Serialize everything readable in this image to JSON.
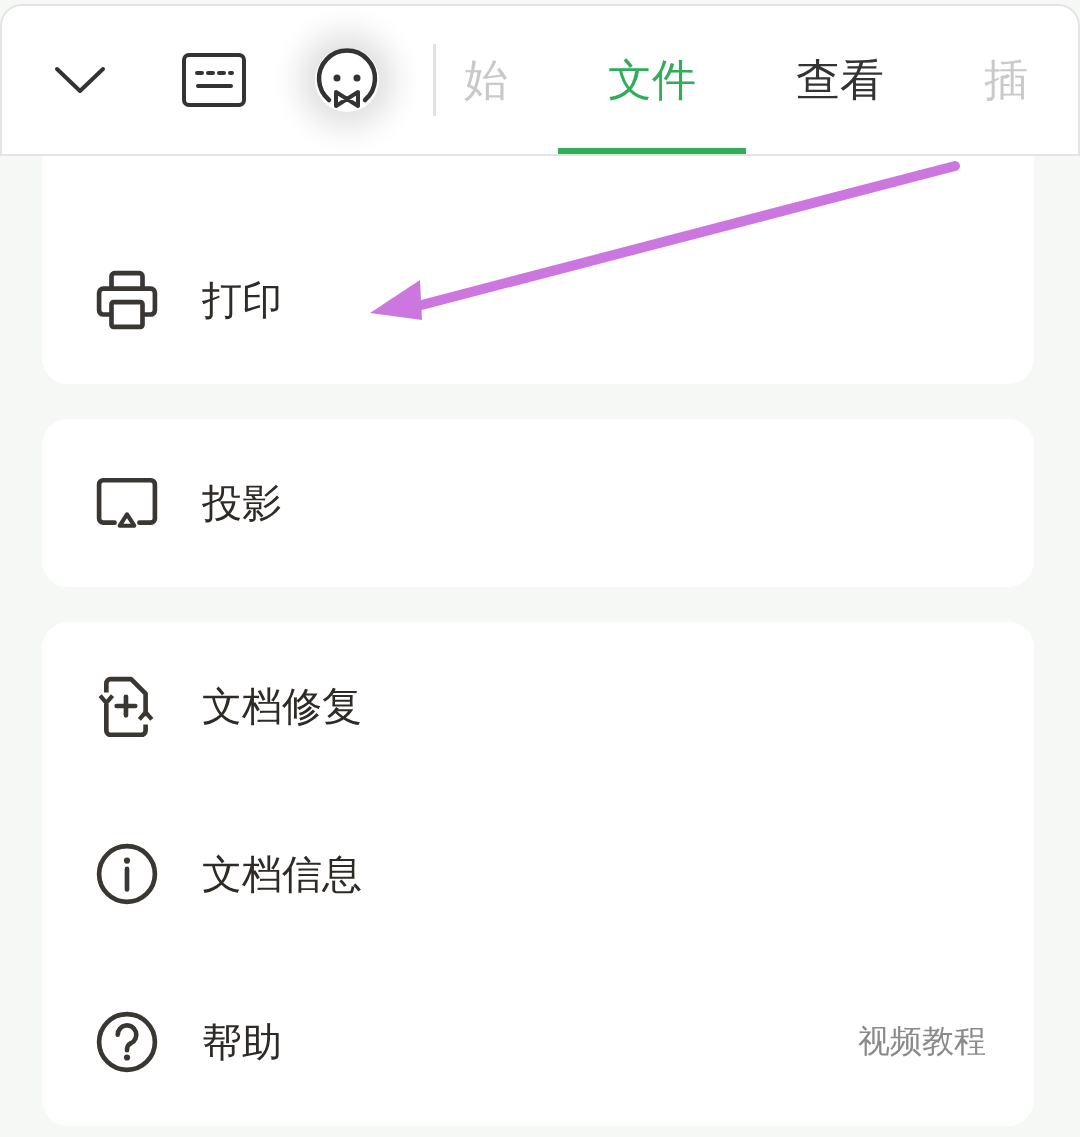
{
  "toolbar": {
    "tabs": [
      {
        "label": "始",
        "selected": false,
        "faded": true
      },
      {
        "label": "文件",
        "selected": true,
        "faded": false
      },
      {
        "label": "查看",
        "selected": false,
        "faded": false
      },
      {
        "label": "插",
        "selected": false,
        "faded": true
      }
    ]
  },
  "groups": [
    {
      "items": [
        {
          "label": "打印"
        }
      ]
    },
    {
      "items": [
        {
          "label": "投影"
        }
      ]
    },
    {
      "items": [
        {
          "label": "文档修复"
        },
        {
          "label": "文档信息"
        },
        {
          "label": "帮助",
          "note": "视频教程"
        }
      ]
    }
  ]
}
